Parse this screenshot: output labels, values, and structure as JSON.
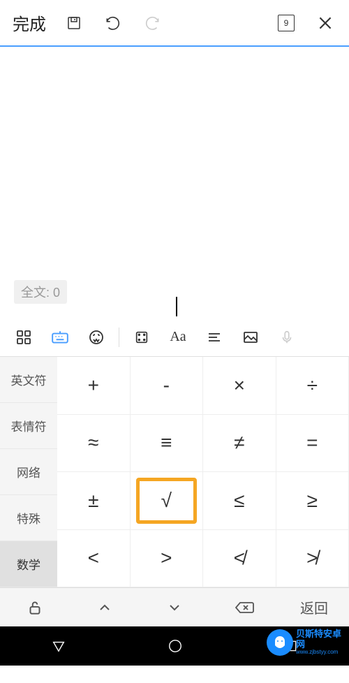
{
  "topBar": {
    "doneLabel": "完成",
    "pageNumber": "9"
  },
  "editor": {
    "wordCountLabel": "全文: 0"
  },
  "categories": [
    {
      "label": "英文符",
      "active": false
    },
    {
      "label": "表情符",
      "active": false
    },
    {
      "label": "网络",
      "active": false
    },
    {
      "label": "特殊",
      "active": false
    },
    {
      "label": "数学",
      "active": true
    }
  ],
  "symbols": [
    {
      "char": "+",
      "highlighted": false
    },
    {
      "char": "-",
      "highlighted": false
    },
    {
      "char": "×",
      "highlighted": false
    },
    {
      "char": "÷",
      "highlighted": false
    },
    {
      "char": "≈",
      "highlighted": false
    },
    {
      "char": "≡",
      "highlighted": false
    },
    {
      "char": "≠",
      "highlighted": false
    },
    {
      "char": "=",
      "highlighted": false
    },
    {
      "char": "±",
      "highlighted": false
    },
    {
      "char": "√",
      "highlighted": true
    },
    {
      "char": "≤",
      "highlighted": false
    },
    {
      "char": "≥",
      "highlighted": false
    },
    {
      "char": "<",
      "highlighted": false
    },
    {
      "char": ">",
      "highlighted": false
    },
    {
      "char": "≮",
      "highlighted": false
    },
    {
      "char": "≯",
      "highlighted": false
    }
  ],
  "bottomToolbar": {
    "returnLabel": "返回"
  },
  "watermark": {
    "main": "贝斯特安卓网",
    "sub": "www.zjbstyy.com"
  }
}
